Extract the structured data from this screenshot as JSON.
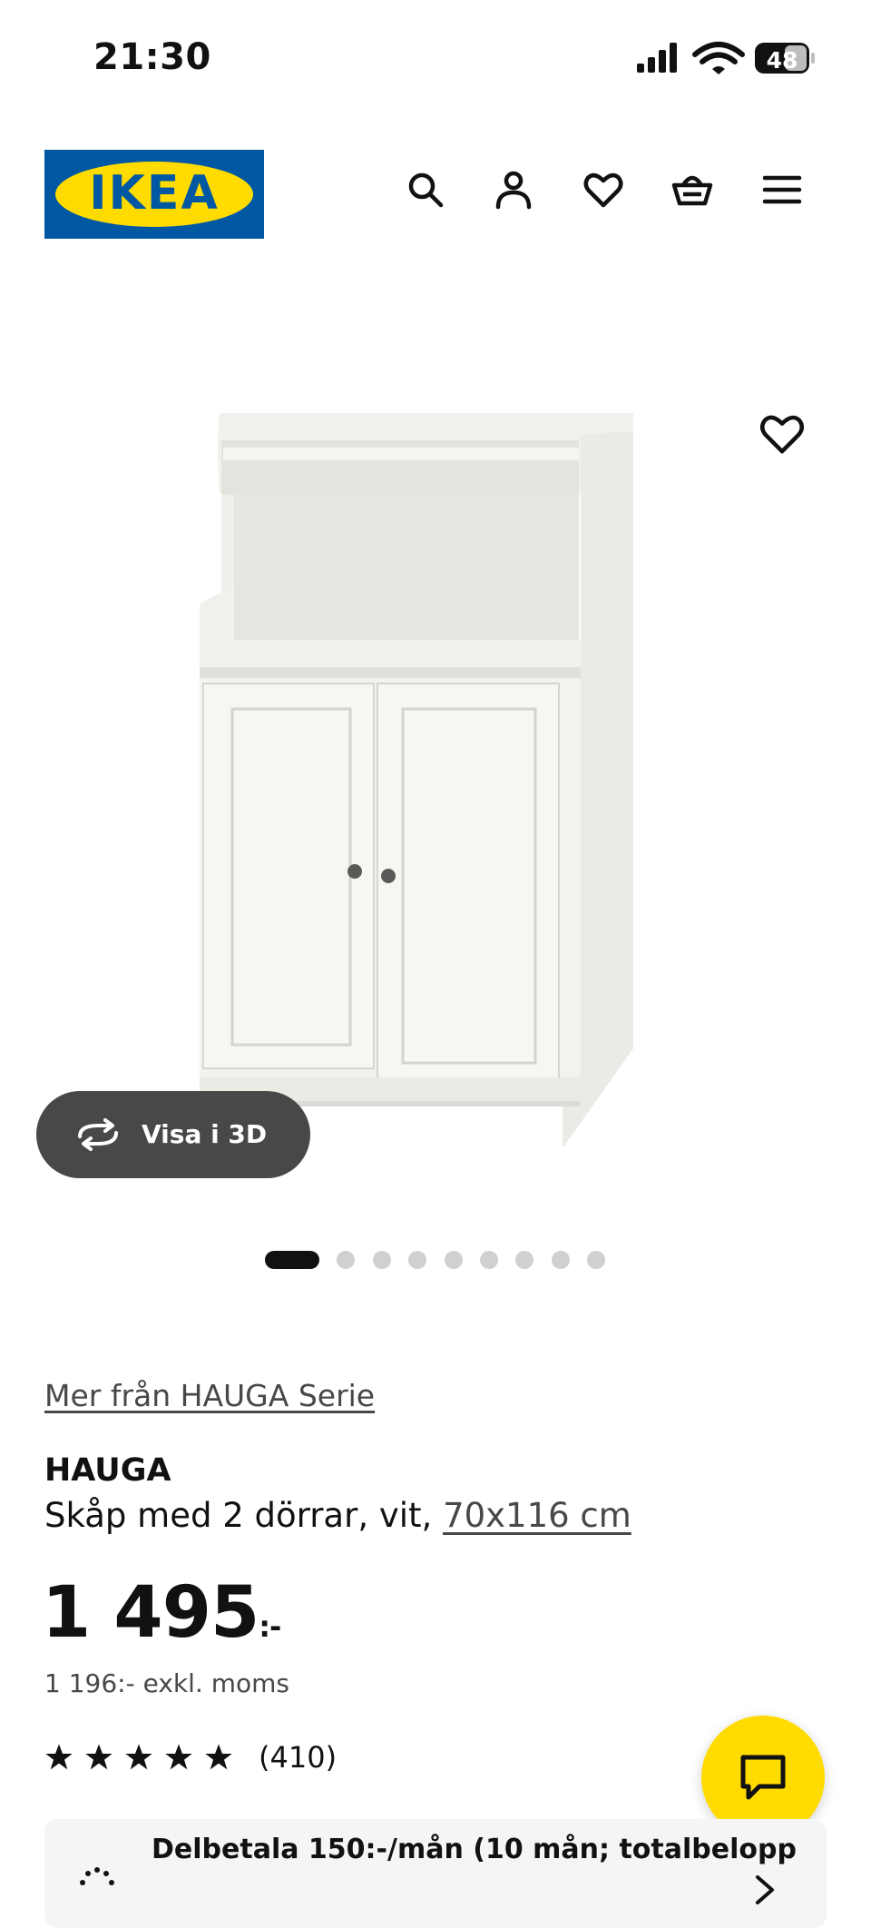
{
  "status_bar": {
    "time": "21:30",
    "battery": "48"
  },
  "header": {
    "logo_text": "IKEA",
    "icons": [
      "search-icon",
      "account-icon",
      "heart-icon",
      "basket-icon",
      "menu-icon"
    ],
    "brand_blue": "#0058a3",
    "brand_yellow": "#ffdb00"
  },
  "gallery": {
    "view_3d_label": "Visa i 3D",
    "image_count": 9,
    "active_index": 0
  },
  "product": {
    "series_link": "Mer från HAUGA Serie",
    "name": "HAUGA",
    "description": "Skåp med 2 dörrar, vit, ",
    "dimensions": "70x116 cm",
    "price_main": "1 495",
    "price_suffix": ":-",
    "price_excl_vat": "1 196:- exkl. moms",
    "rating_stars": 5,
    "review_count": "(410)"
  },
  "installment": {
    "text": "Delbetala 150:-/mån (10 mån; totalbelopp"
  }
}
